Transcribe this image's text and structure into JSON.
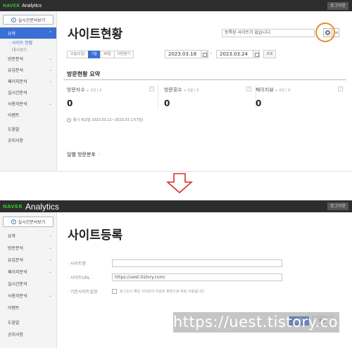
{
  "top": {
    "brand_naver": "NAVER",
    "brand_analytics": "Analytics",
    "logout_label": "로그아웃"
  },
  "sidebar": {
    "realtime_button": "실시간분석보기",
    "panel1_items": [
      {
        "label": "요약",
        "active": true
      },
      {
        "label": "방문분석"
      },
      {
        "label": "유입분석"
      },
      {
        "label": "페이지분석"
      },
      {
        "label": "실시간분석"
      },
      {
        "label": "사용자분석"
      },
      {
        "label": "이벤트"
      },
      {
        "label": "도움말"
      },
      {
        "label": "공지사항"
      }
    ],
    "panel1_subitems": [
      "· 사이트 현황",
      "· 대시보드"
    ],
    "panel2_items": [
      {
        "label": "요약"
      },
      {
        "label": "방문분석"
      },
      {
        "label": "유입분석"
      },
      {
        "label": "페이지분석"
      },
      {
        "label": "실시간분석"
      },
      {
        "label": "사용자분석"
      },
      {
        "label": "이벤트"
      },
      {
        "label": "도움말"
      },
      {
        "label": "공지사항"
      }
    ]
  },
  "site_status": {
    "title": "사이트현황",
    "site_select_value": "등록된 사이트가 없습니다.",
    "more_label": "≡",
    "period_tabs": [
      {
        "label": "오늘(1일)"
      },
      {
        "label": "7일",
        "active": true
      },
      {
        "label": "30일"
      },
      {
        "label": "이번분기"
      }
    ],
    "start_date": "2023.03.18",
    "end_date": "2023.03.24",
    "query_label": "조회",
    "summary_title": "방문현황 요약",
    "stats": [
      {
        "label": "방문자수",
        "sub": "+ 0건 | 0",
        "value": "0"
      },
      {
        "label": "방문횟수",
        "sub": "+ 0일 | 0",
        "value": "0"
      },
      {
        "label": "페이지뷰",
        "sub": "+ 0건 | 0",
        "value": "0"
      }
    ],
    "stat_arrow": "›",
    "info_mark": "i",
    "compare_note": "동기 비교일 2023.03.11~2023.03.17(7일)",
    "daily_title": "일별 방문분포",
    "daily_arrow": "›"
  },
  "site_register": {
    "title": "사이트등록",
    "fields": [
      {
        "label": "· 사이트명",
        "value": ""
      },
      {
        "label": "· 사이트URL",
        "value": "https://uest.tistory.com/"
      }
    ],
    "checkbox_label": "· 기본사이트설정",
    "checkbox_text": "로그인시 해당 사이트의 리포트 화면으로 바로 이동합니다.",
    "register_label": "등록",
    "cancel_label": "취소"
  },
  "watermark": "https://uest.tistory.com",
  "colors": {
    "accent": "#3b6fd3",
    "highlight": "#f08a24",
    "topbar": "#2d2d2d",
    "naver_green": "#2dbd2d"
  }
}
